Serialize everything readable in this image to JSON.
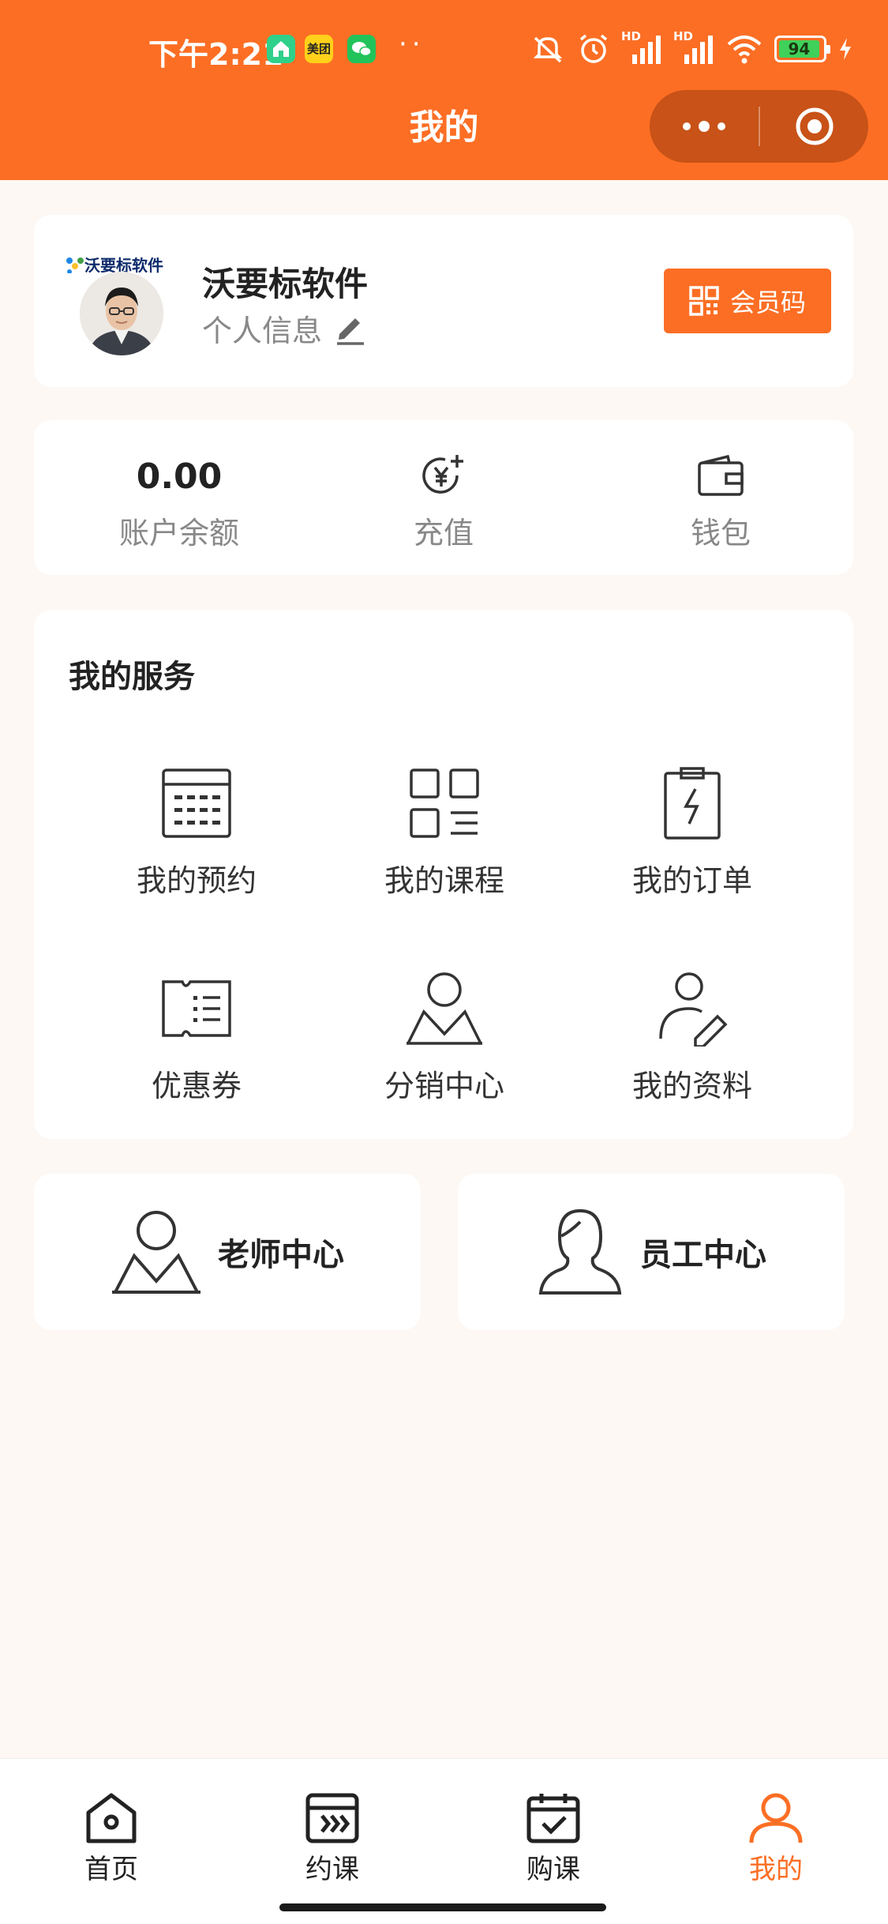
{
  "status_bar": {
    "time": "下午2:21",
    "app_badge": "美团",
    "battery": "94",
    "signal_label_1": "HD",
    "signal_label_2": "HD"
  },
  "nav": {
    "title": "我的"
  },
  "profile": {
    "logo_text": "沃要标软件",
    "name": "沃要标软件",
    "subtitle": "个人信息",
    "member_code_label": "会员码"
  },
  "wallet": {
    "balance_value": "0.00",
    "balance_label": "账户余额",
    "recharge_label": "充值",
    "wallet_label": "钱包"
  },
  "services": {
    "title": "我的服务",
    "items": [
      {
        "label": "我的预约",
        "icon": "calendar-icon"
      },
      {
        "label": "我的课程",
        "icon": "grid-list-icon"
      },
      {
        "label": "我的订单",
        "icon": "clipboard-bolt-icon"
      },
      {
        "label": "优惠券",
        "icon": "coupon-icon"
      },
      {
        "label": "分销中心",
        "icon": "person-icon"
      },
      {
        "label": "我的资料",
        "icon": "person-edit-icon"
      }
    ]
  },
  "centers": {
    "teacher": "老师中心",
    "staff": "员工中心"
  },
  "tabbar": {
    "items": [
      {
        "label": "首页",
        "icon": "home-icon"
      },
      {
        "label": "约课",
        "icon": "book-class-icon"
      },
      {
        "label": "购课",
        "icon": "calendar-check-icon"
      },
      {
        "label": "我的",
        "icon": "user-icon"
      }
    ],
    "active_index": 3
  },
  "colors": {
    "accent": "#fc6e24",
    "capsule": "#c85217",
    "background": "#fdf8f4"
  }
}
